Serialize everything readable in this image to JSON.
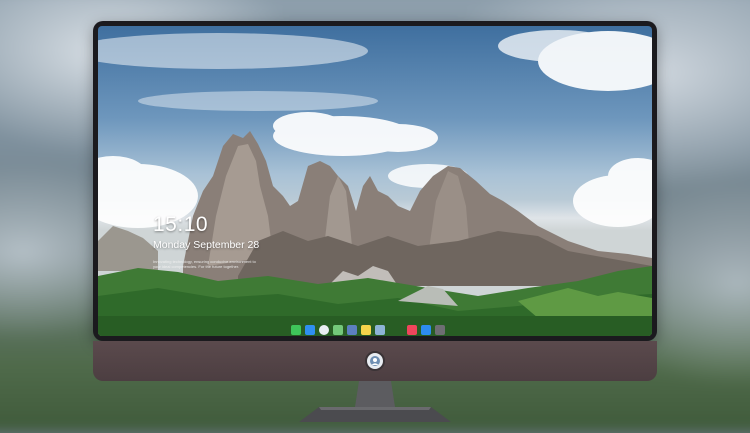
{
  "lock_screen": {
    "time": "15:10",
    "date": "Monday September 28",
    "tagline": "Innovating technology, ensuring conducive environment to your ideal competencies. For the future together."
  },
  "dock": {
    "items": [
      {
        "name": "messages",
        "color": "#3fc55a"
      },
      {
        "name": "finder",
        "color": "#2f8ff0"
      },
      {
        "name": "safari",
        "color": "#e9eef2"
      },
      {
        "name": "maps",
        "color": "#74c87a"
      },
      {
        "name": "launchpad",
        "color": "#5c7fbf"
      },
      {
        "name": "notes",
        "color": "#f5d44b"
      },
      {
        "name": "preview",
        "color": "#8db3d6"
      },
      {
        "name": "music",
        "color": "#f0455c"
      },
      {
        "name": "app-store",
        "color": "#2d8cf0"
      },
      {
        "name": "photo-booth",
        "color": "#6e6e73"
      }
    ]
  },
  "colors": {
    "bezel": "#1b1a1e",
    "chin": "#4f4144",
    "stand": "#505054"
  }
}
